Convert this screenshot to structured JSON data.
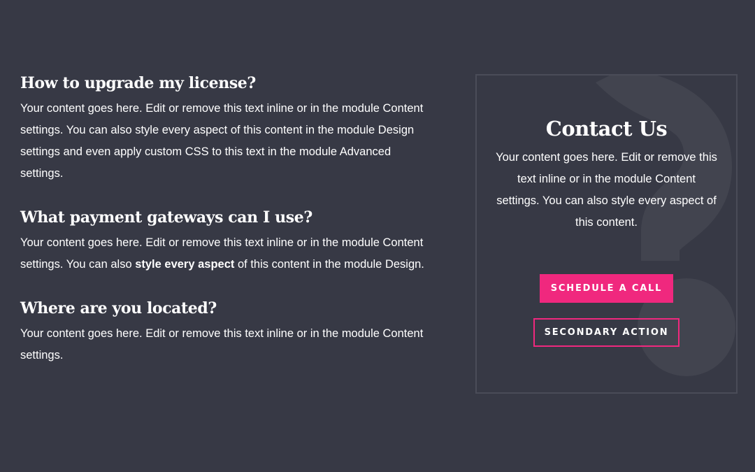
{
  "faq": [
    {
      "question": "How to upgrade my license?",
      "answer": "Your content goes here. Edit or remove this text inline or in the module Content settings. You can also style every aspect of this content in the module Design settings and even apply custom CSS to this text in the module Advanced settings."
    },
    {
      "question": "What payment gateways can I use?",
      "answer_before": "Your content goes here. Edit or remove this text inline or in the module Content settings. You can also ",
      "answer_bold": "style every aspect",
      "answer_after": " of this content in the module Design."
    },
    {
      "question": "Where are you located?",
      "answer": "Your content goes here. Edit or remove this text inline or in the module Content settings."
    }
  ],
  "contact": {
    "title": "Contact Us",
    "text": "Your content goes here. Edit or remove this text inline or in the module Content settings. You can also style every aspect of this content.",
    "primary_button": "Schedule a Call",
    "secondary_button": "Secondary Action",
    "background_icon": "question-mark-icon"
  },
  "colors": {
    "background": "#373945",
    "accent": "#f0287e",
    "card_border": "#4a4c58",
    "watermark": "#42444f"
  }
}
